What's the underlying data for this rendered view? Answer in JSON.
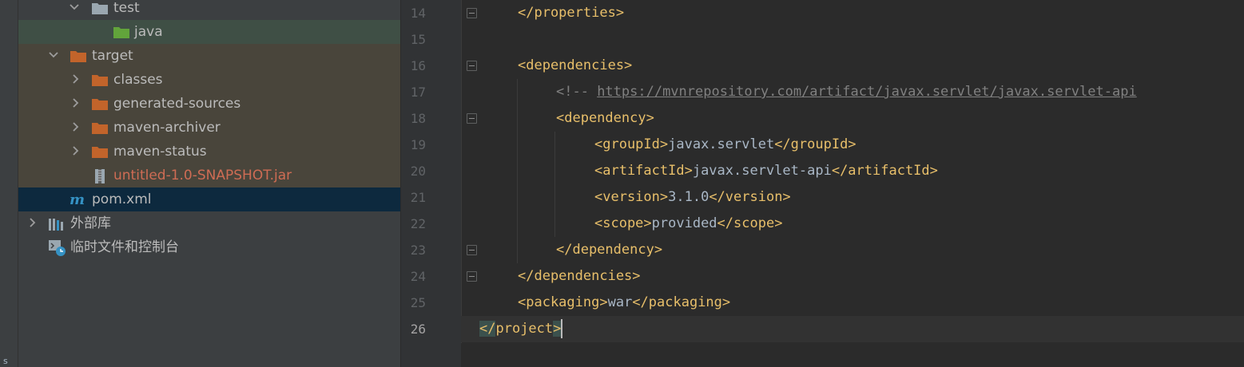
{
  "side_strip": {
    "letter": "s"
  },
  "tree": {
    "items": [
      {
        "label": "test",
        "kind": "folder-grey",
        "expanded": true
      },
      {
        "label": "java",
        "kind": "folder-green"
      },
      {
        "label": "target",
        "kind": "folder-orange",
        "expanded": true
      },
      {
        "label": "classes",
        "kind": "folder-orange",
        "expanded": false
      },
      {
        "label": "generated-sources",
        "kind": "folder-orange",
        "expanded": false
      },
      {
        "label": "maven-archiver",
        "kind": "folder-orange",
        "expanded": false
      },
      {
        "label": "maven-status",
        "kind": "folder-orange",
        "expanded": false
      },
      {
        "label": "untitled-1.0-SNAPSHOT.jar",
        "kind": "jar-file"
      },
      {
        "label": "pom.xml",
        "kind": "maven-file",
        "selected": true
      },
      {
        "label": "外部库",
        "kind": "library",
        "expanded": false
      },
      {
        "label": "临时文件和控制台",
        "kind": "scratches"
      }
    ]
  },
  "editor": {
    "line_numbers": [
      "14",
      "15",
      "16",
      "17",
      "18",
      "19",
      "20",
      "21",
      "22",
      "23",
      "24",
      "25",
      "26"
    ],
    "current_line": "26",
    "lines": {
      "l14": {
        "tag_open": "</properties>"
      },
      "l16": {
        "tag_open": "<dependencies>"
      },
      "l17": {
        "comment_start": "<!-- ",
        "url": "https://mvnrepository.com/artifact/javax.servlet/javax.servlet-api"
      },
      "l18": {
        "tag_open": "<dependency>"
      },
      "l19": {
        "open": "<groupId>",
        "value": "javax.servlet",
        "close": "</groupId>"
      },
      "l20": {
        "open": "<artifactId>",
        "value": "javax.servlet-api",
        "close": "</artifactId>"
      },
      "l21": {
        "open": "<version>",
        "value": "3.1.0",
        "close": "</version>"
      },
      "l22": {
        "open": "<scope>",
        "value": "provided",
        "close": "</scope>"
      },
      "l23": {
        "tag_open": "</dependency>"
      },
      "l24": {
        "tag_open": "</dependencies>"
      },
      "l25": {
        "open": "<packaging>",
        "value": "war",
        "close": "</packaging>"
      },
      "l26": {
        "lt": "</",
        "name": "project",
        "gt": ">"
      }
    }
  },
  "colors": {
    "tree_bg": "#3c3f41",
    "editor_bg": "#2b2b2b",
    "gutter_bg": "#313335",
    "xml_tag": "#e8bf6a",
    "xml_text": "#a9b7c6",
    "comment": "#808080",
    "line_number": "#606366",
    "selection_row": "#0d293e",
    "folder_orange": "#c2642b",
    "folder_green": "#62a43b",
    "folder_grey": "#9aa7b0",
    "jar_text": "#cf6c54",
    "maven_blue": "#3592c4"
  }
}
